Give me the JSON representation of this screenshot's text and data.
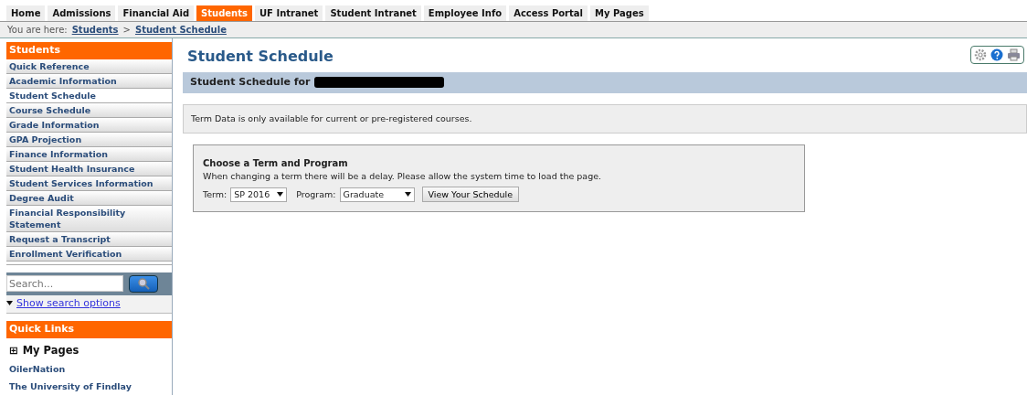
{
  "top_nav": [
    {
      "label": "Home",
      "selected": false
    },
    {
      "label": "Admissions",
      "selected": false
    },
    {
      "label": "Financial Aid",
      "selected": false
    },
    {
      "label": "Students",
      "selected": true
    },
    {
      "label": "UF Intranet",
      "selected": false
    },
    {
      "label": "Student Intranet",
      "selected": false
    },
    {
      "label": "Employee Info",
      "selected": false
    },
    {
      "label": "Access Portal",
      "selected": false
    },
    {
      "label": "My Pages",
      "selected": false
    }
  ],
  "breadcrumb": {
    "prefix": "You are here:",
    "items": [
      "Students",
      "Student Schedule"
    ],
    "separator": ">"
  },
  "sidebar": {
    "title": "Students",
    "items": [
      {
        "label": "Quick Reference",
        "selected": false
      },
      {
        "label": "Academic Information",
        "selected": false
      },
      {
        "label": "Student Schedule",
        "selected": true
      },
      {
        "label": "Course Schedule",
        "selected": false
      },
      {
        "label": "Grade Information",
        "selected": false
      },
      {
        "label": "GPA Projection",
        "selected": false
      },
      {
        "label": "Finance Information",
        "selected": false
      },
      {
        "label": "Student Health Insurance",
        "selected": false
      },
      {
        "label": "Student Services Information",
        "selected": false
      },
      {
        "label": "Degree Audit",
        "selected": false
      },
      {
        "label": "Financial Responsibility Statement",
        "selected": false
      },
      {
        "label": "Request a Transcript",
        "selected": false
      },
      {
        "label": "Enrollment Verification",
        "selected": false
      }
    ]
  },
  "search": {
    "placeholder": "Search...",
    "options_link": "Show search options"
  },
  "quick_links": {
    "title": "Quick Links",
    "group": {
      "expander": "⊞",
      "label": "My Pages"
    },
    "links": [
      "OilerNation",
      "The University of Findlay"
    ]
  },
  "page_title": "Student Schedule",
  "schedule_header": "Student Schedule for",
  "notice": "Term Data is only available for current or pre-registered courses.",
  "term_box": {
    "title": "Choose a Term and Program",
    "hint": "When changing a term there will be a delay. Please allow the system time to load the page.",
    "term_label": "Term:",
    "term_value": "SP 2016",
    "program_label": "Program:",
    "program_value": "Graduate",
    "button": "View Your Schedule"
  }
}
